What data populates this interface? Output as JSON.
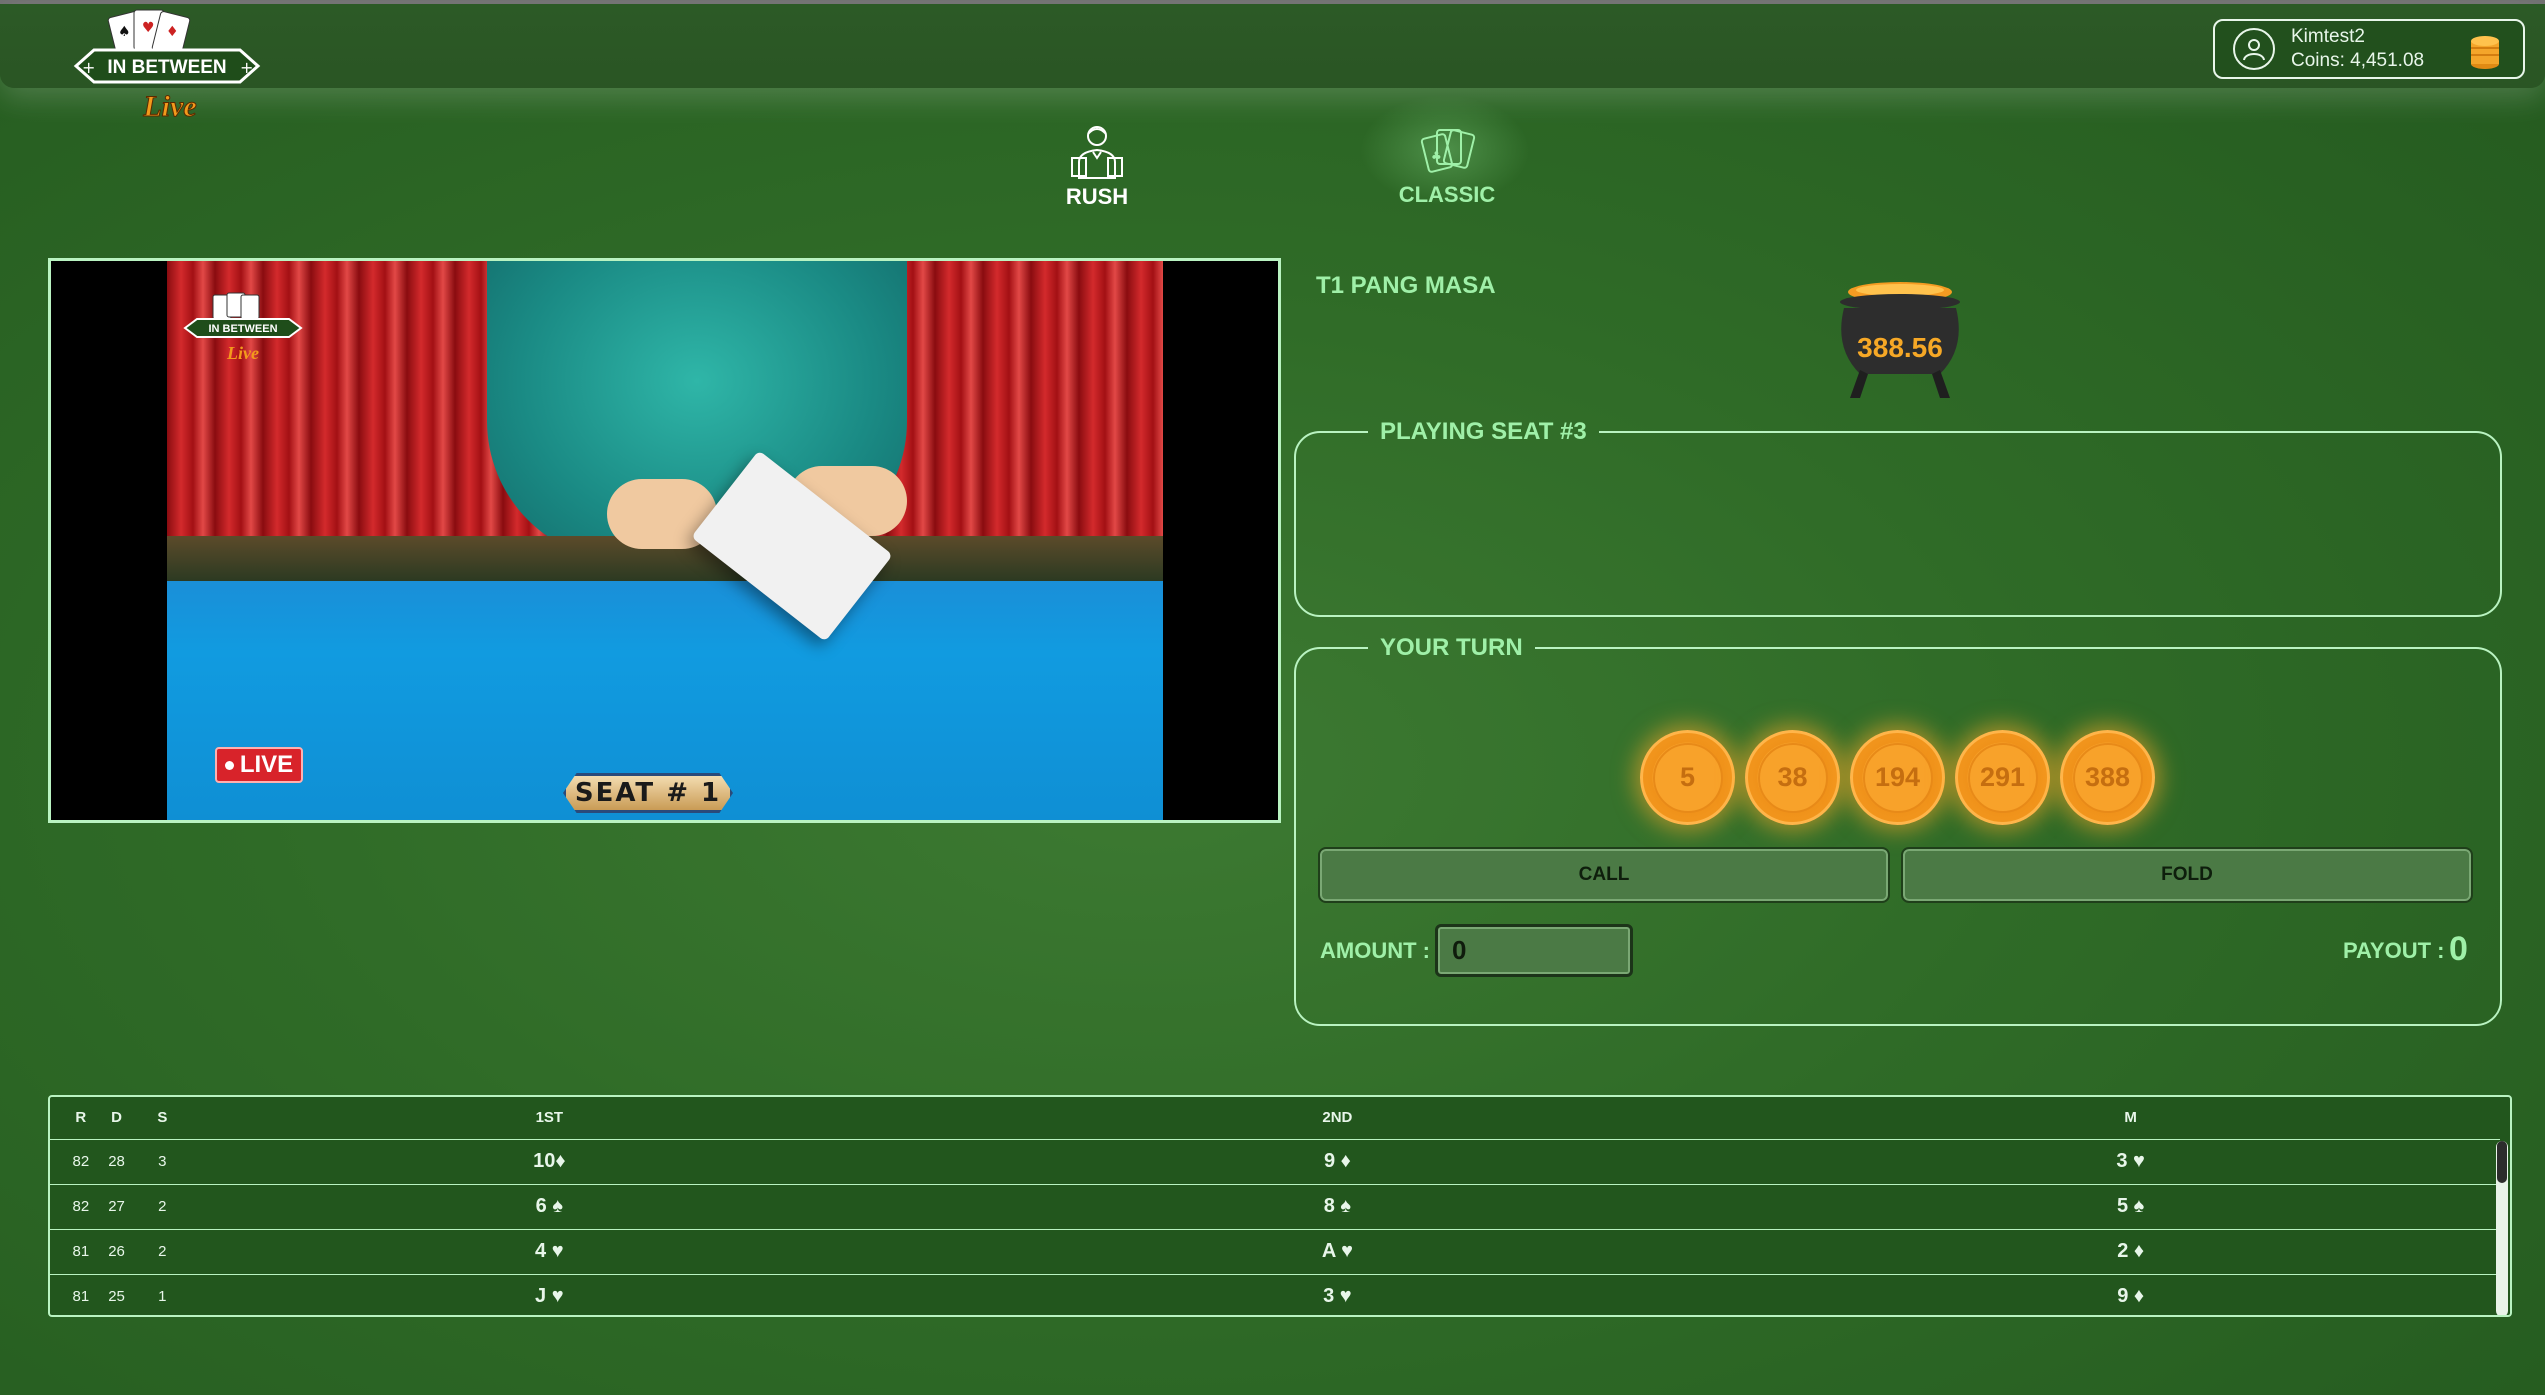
{
  "header": {
    "logo_text": "IN BETWEEN",
    "logo_script": "Live",
    "username": "Kimtest2",
    "coins_label": "Coins: 4,451.08"
  },
  "modes": [
    {
      "label": "RUSH",
      "icon": "dealer-icon",
      "active": false
    },
    {
      "label": "CLASSIC",
      "icon": "cards-icon",
      "active": true
    }
  ],
  "video": {
    "live_label": "LIVE",
    "seat_label": "SEAT # 1",
    "overlay_logo_text": "IN BETWEEN"
  },
  "table": {
    "name": "T1 PANG MASA",
    "pot_value": "388.56"
  },
  "seat_panel": {
    "title": "PLAYING SEAT #3"
  },
  "turn_panel": {
    "title": "YOUR TURN",
    "chips": [
      "5",
      "38",
      "194",
      "291",
      "388"
    ],
    "call_label": "CALL",
    "fold_label": "FOLD",
    "amount_label": "AMOUNT :",
    "amount_value": "0",
    "payout_label": "PAYOUT :",
    "payout_value": "0"
  },
  "colors": {
    "accent": "#9ff0a8",
    "chip": "#f49b22",
    "live": "#d8232a"
  },
  "history": {
    "headers": [
      "R",
      "D",
      "S",
      "1ST",
      "2ND",
      "M"
    ],
    "rows": [
      {
        "r": "82",
        "d": "28",
        "s": "3",
        "first": "10♦",
        "second": "9 ♦",
        "m": "3 ♥"
      },
      {
        "r": "82",
        "d": "27",
        "s": "2",
        "first": "6 ♠",
        "second": "8 ♠",
        "m": "5 ♠"
      },
      {
        "r": "81",
        "d": "26",
        "s": "2",
        "first": "4 ♥",
        "second": "A ♥",
        "m": "2 ♦"
      },
      {
        "r": "81",
        "d": "25",
        "s": "1",
        "first": "J ♥",
        "second": "3 ♥",
        "m": "9 ♦"
      }
    ]
  }
}
